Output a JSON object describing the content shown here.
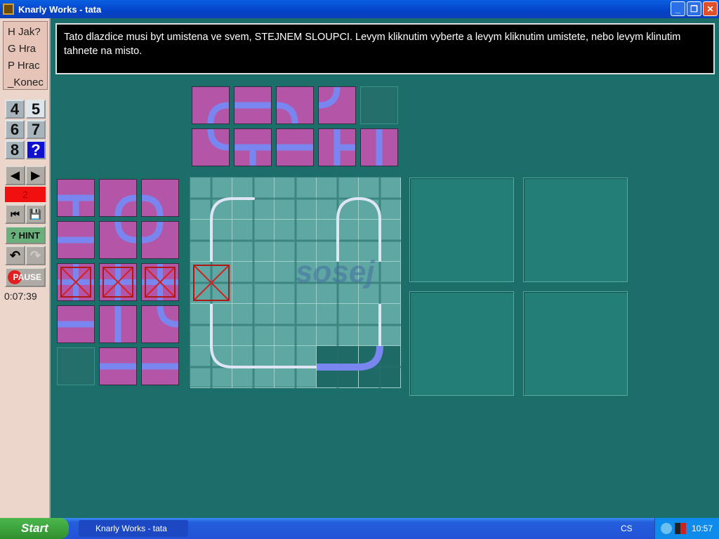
{
  "window": {
    "title": "Knarly Works - tata",
    "minimize": "_",
    "maximize": "❐",
    "close": "✕"
  },
  "menu": [
    {
      "label": "H Jak?"
    },
    {
      "label": "G Hra"
    },
    {
      "label": "P Hrac"
    },
    {
      "label": "_Konec"
    }
  ],
  "levels": [
    "4",
    "5",
    "6",
    "7",
    "8",
    "?"
  ],
  "controls": {
    "prev": "◀",
    "next": "▶",
    "counter": "2",
    "rewind": "⏮",
    "save": "💾",
    "hint": "? HINT",
    "undo": "↶",
    "redo": "↷",
    "pause": "PAUSE"
  },
  "timer": "0:07:39",
  "message": "Tato dlazdice musi byt umistena ve svem, STEJNEM SLOUPCI. Levym kliknutim vyberte a levym kliknutim umistete, nebo levym klinutim tahnete na misto.",
  "watermark": "sosej",
  "top_tray": [
    [
      "es",
      "ew",
      "ws",
      "nw",
      ""
    ],
    [
      "ne",
      "ews",
      "ew",
      "nse",
      "ns"
    ]
  ],
  "left_tray": [
    [
      "ews",
      "es",
      "ws"
    ],
    [
      "ew",
      "ne",
      "nw"
    ],
    [
      "X",
      "X",
      "X"
    ],
    [
      "ew",
      "ns",
      "ne"
    ],
    [
      "",
      "ew",
      "ew"
    ]
  ],
  "board": [
    [
      "h:es",
      "h:w",
      "",
      "h:es",
      "h:ws"
    ],
    [
      "h:ns",
      "",
      "",
      "h:ns",
      "h:ns"
    ],
    [
      "X",
      "",
      "",
      "",
      ""
    ],
    [
      "h:ns",
      "",
      "",
      "",
      "h:ns"
    ],
    [
      "h:ne",
      "h:ew",
      "h:ew",
      "p:ew",
      "p:nw"
    ]
  ],
  "taskbar": {
    "start": "Start",
    "task": "Knarly Works - tata",
    "lang": "CS",
    "clock": "10:57"
  },
  "colors": {
    "tile": "#b456a8",
    "pipe": "#7a86f0",
    "board": "#5ea7a2",
    "bg": "#1c6e6a"
  }
}
